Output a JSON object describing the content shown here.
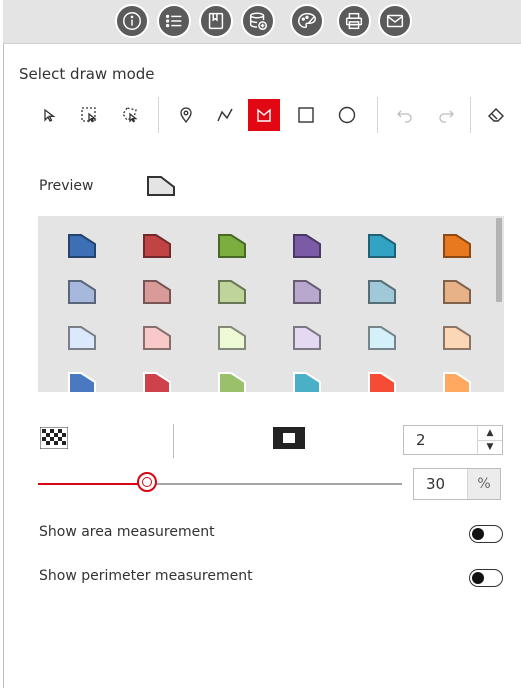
{
  "toolbar": {
    "buttons": [
      {
        "name": "info-icon"
      },
      {
        "name": "list-icon"
      },
      {
        "name": "bookmark-icon"
      },
      {
        "name": "database-add-icon"
      },
      {
        "name": "palette-icon"
      },
      {
        "name": "print-icon"
      },
      {
        "name": "mail-icon"
      }
    ]
  },
  "draw": {
    "heading": "Select draw mode",
    "tools": [
      "select-icon",
      "select-rectangle-icon",
      "select-lasso-icon",
      "point-icon",
      "polyline-icon",
      "polygon-icon",
      "rectangle-icon",
      "circle-icon",
      "undo-icon",
      "redo-icon",
      "eraser-icon"
    ],
    "active_tool": "polygon-icon"
  },
  "preview": {
    "label": "Preview"
  },
  "symbols": {
    "rows": [
      [
        "#3c6fb6",
        "#c04444",
        "#7cae3f",
        "#7b5ba6",
        "#33a3c4",
        "#e9791f"
      ],
      [
        "#a6b8dc",
        "#d99a9a",
        "#bfd49b",
        "#b8a8cf",
        "#9fc8d9",
        "#e8b288"
      ],
      [
        "#dce8fb",
        "#f9c8c8",
        "#eef9d6",
        "#e4d8f3",
        "#d4f1fa",
        "#fbd7b5"
      ],
      [
        "#4a78c1",
        "#d0424b",
        "#9bc06b",
        "#4ab0c7",
        "#f54c35",
        "#ffa860"
      ]
    ]
  },
  "controls": {
    "width_value": "2",
    "opacity_value": "30",
    "opacity_unit": "%",
    "opacity_fraction": 0.3
  },
  "options": {
    "show_area": "Show area measurement",
    "show_perimeter": "Show perimeter measurement"
  },
  "colors": {
    "accent": "#e10713",
    "toolbar_bg": "#e4e4e4",
    "button_bg": "#5b5b5b"
  }
}
